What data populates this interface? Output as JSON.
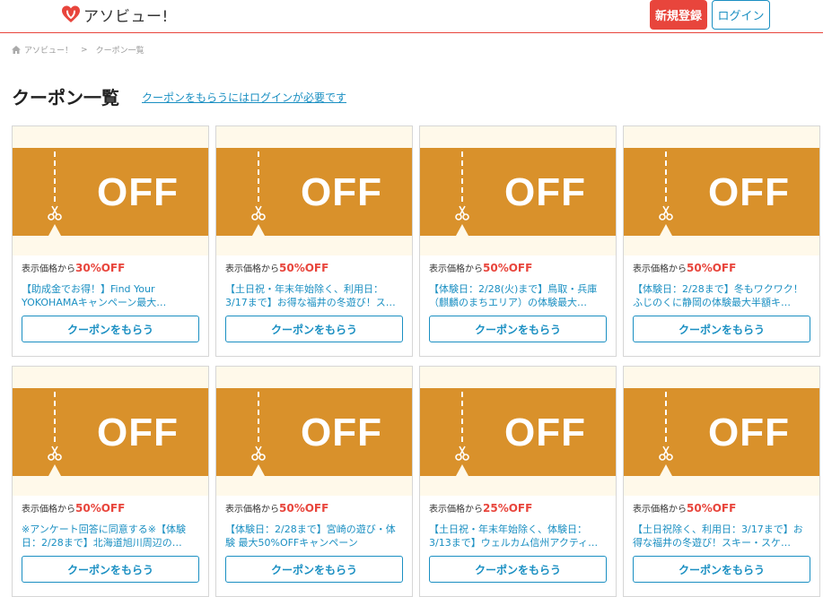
{
  "header": {
    "logo_text": "アソビュー!",
    "register_label": "新規登録",
    "login_label": "ログイン",
    "colors": {
      "accent": "#e8453c",
      "link": "#1a8fc2",
      "coupon_band": "#d9912b",
      "coupon_bg": "#fff9ea"
    }
  },
  "breadcrumb": {
    "home": "アソビュー！",
    "separator": ">",
    "current": "クーポン一覧"
  },
  "page": {
    "title": "クーポン一覧",
    "login_note": "クーポンをもらうにはログインが必要です"
  },
  "coupons": [
    {
      "off_label": "OFF",
      "price_prefix": "表示価格から",
      "rate": "30%OFF",
      "desc": "【助成金でお得！】Find Your YOKOHAMAキャンペーン最大…",
      "button": "クーポンをもらう"
    },
    {
      "off_label": "OFF",
      "price_prefix": "表示価格から",
      "rate": "50%OFF",
      "desc": "【土日祝・年末年始除く、利用日：3/17まで】お得な福井の冬遊び！ス…",
      "button": "クーポンをもらう"
    },
    {
      "off_label": "OFF",
      "price_prefix": "表示価格から",
      "rate": "50%OFF",
      "desc": "【体験日：2/28(火)まで】鳥取・兵庫（麒麟のまちエリア）の体験最大…",
      "button": "クーポンをもらう"
    },
    {
      "off_label": "OFF",
      "price_prefix": "表示価格から",
      "rate": "50%OFF",
      "desc": "【体験日：2/28まで】冬もワクワク！ふじのくに静岡の体験最大半額キ…",
      "button": "クーポンをもらう"
    },
    {
      "off_label": "OFF",
      "price_prefix": "表示価格から",
      "rate": "50%OFF",
      "desc": "※アンケート回答に同意する※【体験日：2/28まで】北海道旭川周辺の…",
      "button": "クーポンをもらう"
    },
    {
      "off_label": "OFF",
      "price_prefix": "表示価格から",
      "rate": "50%OFF",
      "desc": "【体験日：2/28まで】宮崎の遊び・体験 最大50%OFFキャンペーン",
      "button": "クーポンをもらう"
    },
    {
      "off_label": "OFF",
      "price_prefix": "表示価格から",
      "rate": "25%OFF",
      "desc": "【土日祝・年末年始除く、体験日：3/13まで】ウェルカム信州アクティ…",
      "button": "クーポンをもらう"
    },
    {
      "off_label": "OFF",
      "price_prefix": "表示価格から",
      "rate": "50%OFF",
      "desc": "【土日祝除く、利用日：3/17まで】お得な福井の冬遊び！スキー・スケ…",
      "button": "クーポンをもらう"
    }
  ]
}
